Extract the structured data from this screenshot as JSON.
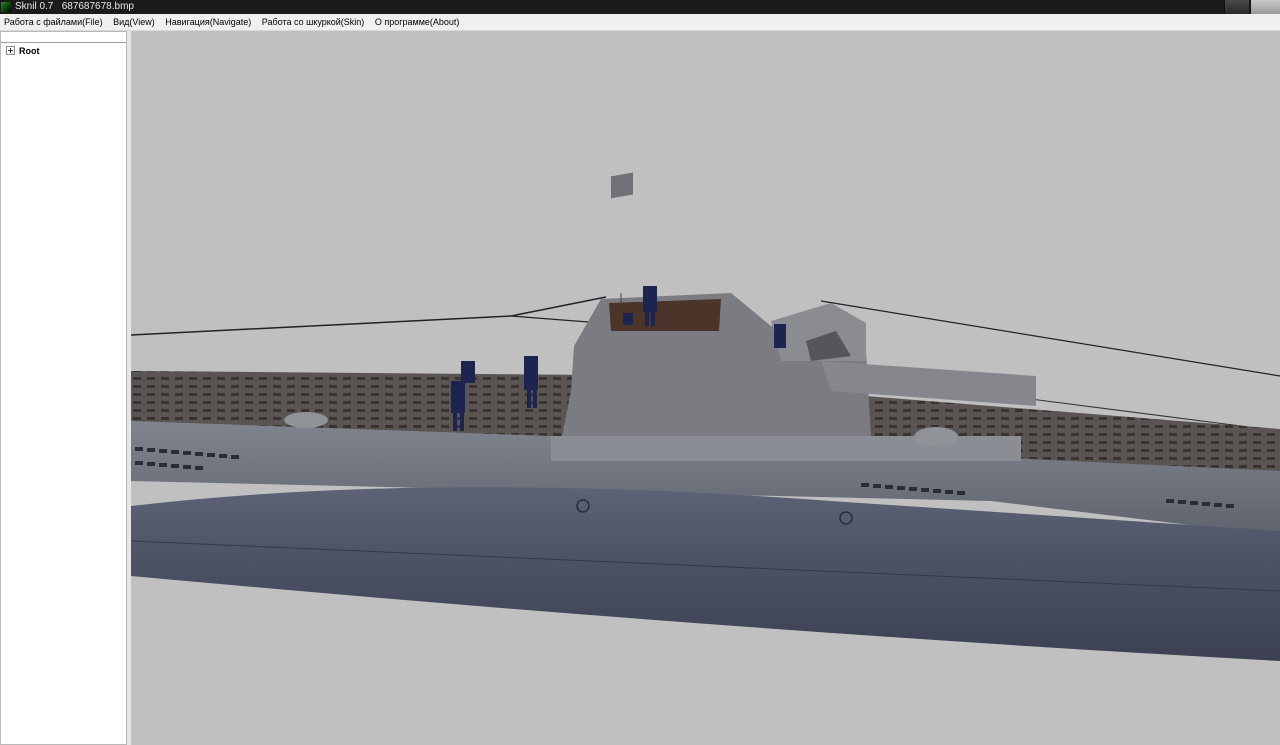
{
  "window": {
    "title": "Sknil 0.7   687687678.bmp",
    "app_icon": "app-icon",
    "accent": "#1b1b1b"
  },
  "menu": {
    "items": [
      "Работа с файлами(File)",
      "Вид(View)",
      "Навигация(Navigate)",
      "Работа со шкуркой(Skin)",
      "О программе(About)"
    ]
  },
  "tree": {
    "root_label": "Root",
    "expander_icon": "plus-expander-icon"
  },
  "viewport": {
    "background": "#c0c0c0",
    "content": "3d-submarine-model"
  }
}
